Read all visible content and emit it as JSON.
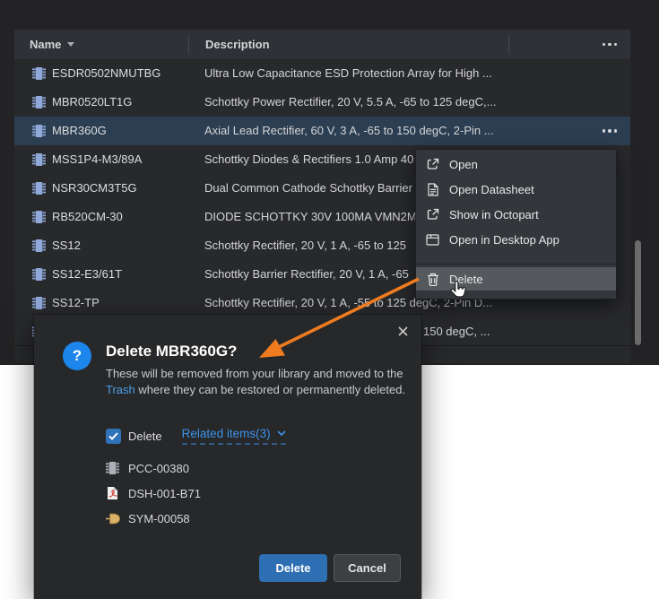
{
  "colors": {
    "page_dark": "#232325",
    "table_bg": "#28292b",
    "header_bg": "#2f3136",
    "selected_row": "#2c3e51",
    "menu_bg": "#33363a",
    "menu_highlight": "#55585c",
    "dialog_bg": "#27282a",
    "accent_blue": "#2d6fb2",
    "link_blue": "#3d92ea",
    "help_circle_blue": "#1d86ec",
    "arrow_orange": "#ee7b20",
    "chip_icon_blue": "#8fa9da"
  },
  "table": {
    "header": {
      "name": "Name",
      "description": "Description"
    },
    "rows": [
      {
        "name": "ESDR0502NMUTBG",
        "description": "Ultra Low Capacitance ESD Protection Array for High ..."
      },
      {
        "name": "MBR0520LT1G",
        "description": "Schottky Power Rectifier, 20 V, 5.5 A, -65 to 125 degC,..."
      },
      {
        "name": "MBR360G",
        "description": "Axial Lead Rectifier, 60 V, 3 A, -65 to 150 degC, 2-Pin ..."
      },
      {
        "name": "MSS1P4-M3/89A",
        "description": "Schottky Diodes & Rectifiers 1.0 Amp 40"
      },
      {
        "name": "NSR30CM3T5G",
        "description": "Dual Common Cathode Schottky Barrier"
      },
      {
        "name": "RB520CM-30",
        "description": "DIODE SCHOTTKY 30V 100MA VMN2M"
      },
      {
        "name": "SS12",
        "description": "Schottky Rectifier, 20 V, 1 A, -65 to 125"
      },
      {
        "name": "SS12-E3/61T",
        "description": "Schottky Barrier Rectifier, 20 V, 1 A, -65"
      },
      {
        "name": "SS12-TP",
        "description": "Schottky Rectifier, 20 V, 1 A, -55 to 125 degC, 2-Pin D..."
      },
      {
        "name": "",
        "description": "150 degC, ..."
      }
    ]
  },
  "context_menu": {
    "items": [
      {
        "label": "Open"
      },
      {
        "label": "Open Datasheet"
      },
      {
        "label": "Show in Octopart"
      },
      {
        "label": "Open in Desktop App"
      }
    ],
    "delete_label": "Delete"
  },
  "dialog": {
    "help_glyph": "?",
    "title": "Delete MBR360G?",
    "body_before_link": "These will be removed from your library and moved to the ",
    "trash_link": "Trash",
    "body_after_link": " where they can be restored or permanently deleted.",
    "checkbox_label": "Delete",
    "related_items_label": "Related items(3)",
    "related_items": [
      {
        "name": "PCC-00380"
      },
      {
        "name": "DSH-001-B71"
      },
      {
        "name": "SYM-00058"
      }
    ],
    "delete_button": "Delete",
    "cancel_button": "Cancel"
  }
}
